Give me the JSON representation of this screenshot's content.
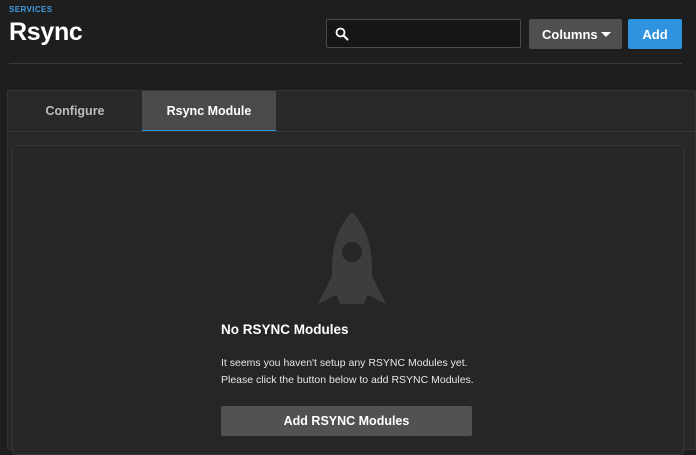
{
  "header": {
    "breadcrumb": "SERVICES",
    "title": "Rsync",
    "search": {
      "icon": "search-icon",
      "value": "",
      "placeholder": ""
    },
    "columns_label": "Columns",
    "add_label": "Add"
  },
  "tabs": [
    {
      "label": "Configure",
      "active": false
    },
    {
      "label": "Rsync Module",
      "active": true
    }
  ],
  "empty_state": {
    "icon": "rocket-icon",
    "title": "No RSYNC Modules",
    "line1": "It seems you haven't setup any RSYNC Modules yet.",
    "line2": "Please click the button below to add RSYNC Modules.",
    "button_label": "Add RSYNC Modules"
  },
  "colors": {
    "accent": "#2f93e0",
    "background": "#1e1e1e",
    "card": "#282828"
  }
}
